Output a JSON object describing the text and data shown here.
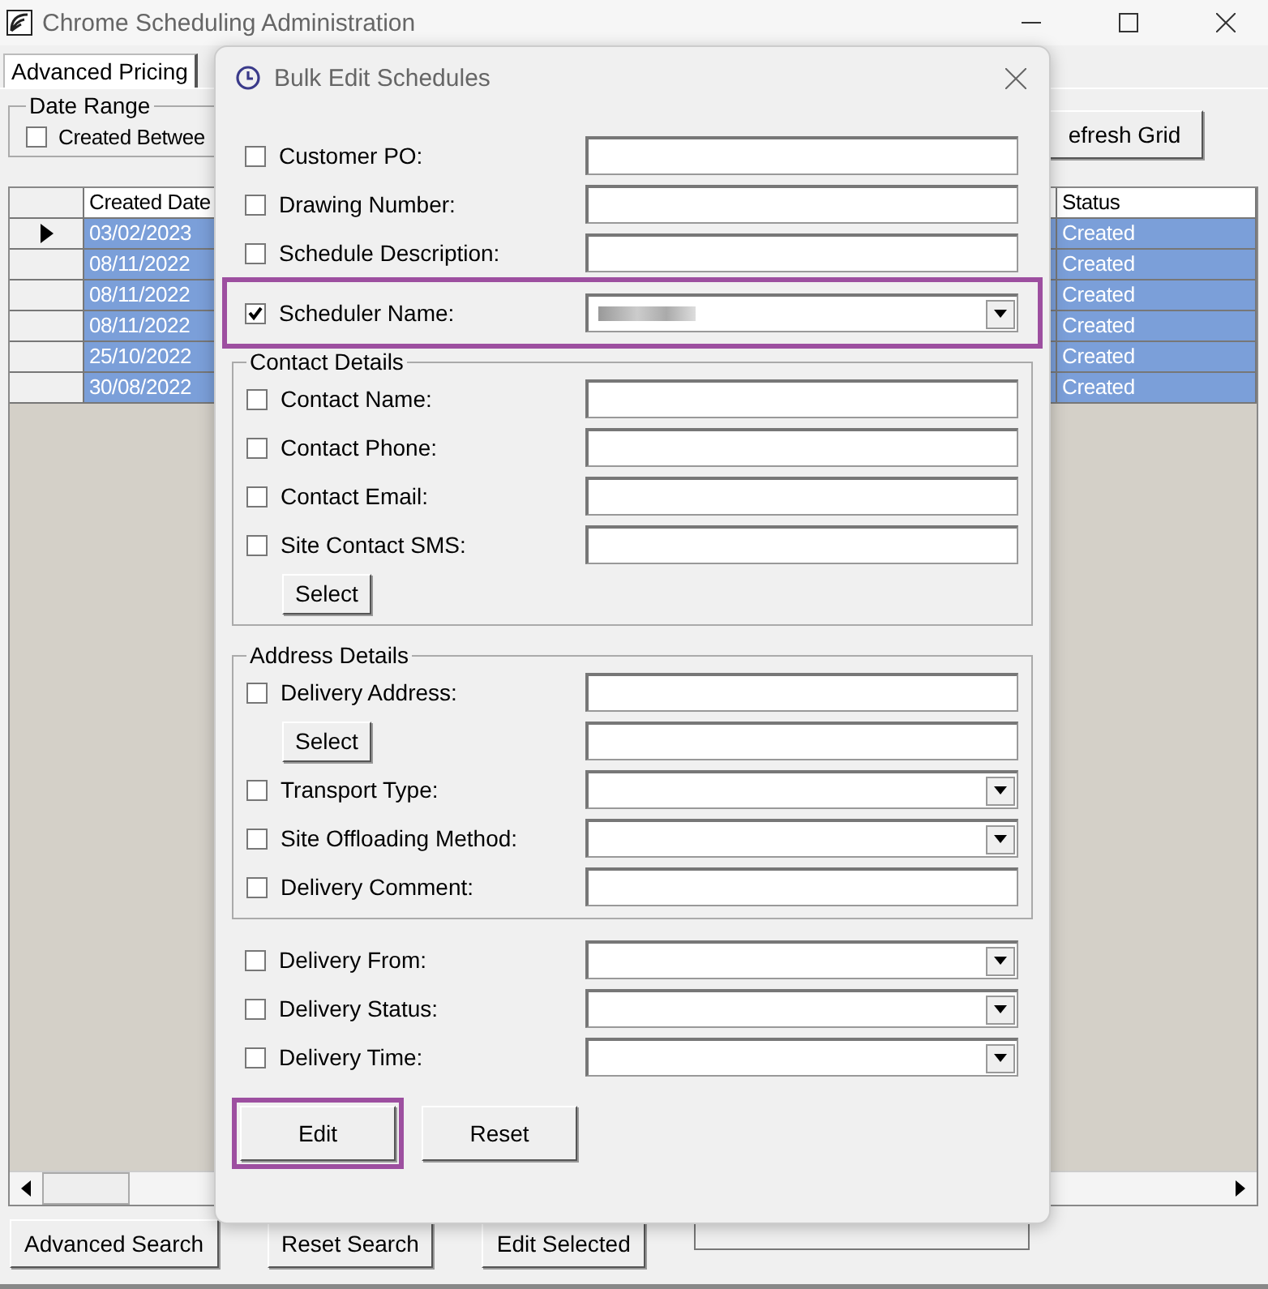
{
  "window": {
    "title": "Chrome Scheduling Administration"
  },
  "tabs": [
    {
      "label": "Advanced Pricing",
      "selected": true
    }
  ],
  "date_range": {
    "title": "Date Range",
    "created_between": {
      "label": "Created Betwee",
      "checked": false
    }
  },
  "refresh_button": "efresh Grid",
  "grid": {
    "columns": [
      "Created Date",
      "Status"
    ],
    "rows": [
      {
        "created_date": "03/02/2023",
        "status": "Created",
        "current": true,
        "selected": true
      },
      {
        "created_date": "08/11/2022",
        "status": "Created",
        "current": false,
        "selected": true
      },
      {
        "created_date": "08/11/2022",
        "status": "Created",
        "current": false,
        "selected": true
      },
      {
        "created_date": "08/11/2022",
        "status": "Created",
        "current": false,
        "selected": true
      },
      {
        "created_date": "25/10/2022",
        "status": "Created",
        "current": false,
        "selected": true
      },
      {
        "created_date": "30/08/2022",
        "status": "Created",
        "current": false,
        "selected": true
      }
    ]
  },
  "bottom_buttons": [
    "Advanced Search",
    "Reset Search",
    "Edit Selected"
  ],
  "dialog": {
    "title": "Bulk Edit Schedules",
    "sections": [
      {
        "fields": [
          {
            "kind": "text",
            "label": "Customer PO:",
            "checked": false,
            "highlighted": false
          },
          {
            "kind": "text",
            "label": "Drawing Number:",
            "checked": false,
            "highlighted": false
          },
          {
            "kind": "text",
            "label": "Schedule Description:",
            "checked": false,
            "highlighted": false
          },
          {
            "kind": "combo",
            "label": "Scheduler Name:",
            "checked": true,
            "highlighted": true,
            "redacted": true
          }
        ]
      },
      {
        "title": "Contact Details",
        "fields": [
          {
            "kind": "text",
            "label": "Contact Name:",
            "checked": false,
            "highlighted": false
          },
          {
            "kind": "text",
            "label": "Contact Phone:",
            "checked": false,
            "highlighted": false
          },
          {
            "kind": "text",
            "label": "Contact Email:",
            "checked": false,
            "highlighted": false
          },
          {
            "kind": "text",
            "label": "Site Contact SMS:",
            "checked": false,
            "highlighted": false
          },
          {
            "kind": "button",
            "label": "Select"
          }
        ]
      },
      {
        "title": "Address Details",
        "fields": [
          {
            "kind": "text",
            "label": "Delivery Address:",
            "checked": false,
            "highlighted": false
          },
          {
            "kind": "button_field",
            "label": "Select"
          },
          {
            "kind": "combo",
            "label": "Transport Type:",
            "checked": false,
            "highlighted": false
          },
          {
            "kind": "combo",
            "label": "Site Offloading Method:",
            "checked": false,
            "highlighted": false
          },
          {
            "kind": "text",
            "label": "Delivery Comment:",
            "checked": false,
            "highlighted": false
          }
        ]
      },
      {
        "fields": [
          {
            "kind": "combo",
            "label": "Delivery From:",
            "checked": false,
            "highlighted": false
          },
          {
            "kind": "combo",
            "label": "Delivery Status:",
            "checked": false,
            "highlighted": false
          },
          {
            "kind": "combo",
            "label": "Delivery Time:",
            "checked": false,
            "highlighted": false
          }
        ]
      }
    ],
    "buttons": [
      {
        "label": "Edit",
        "highlighted": true
      },
      {
        "label": "Reset",
        "highlighted": false
      }
    ]
  }
}
